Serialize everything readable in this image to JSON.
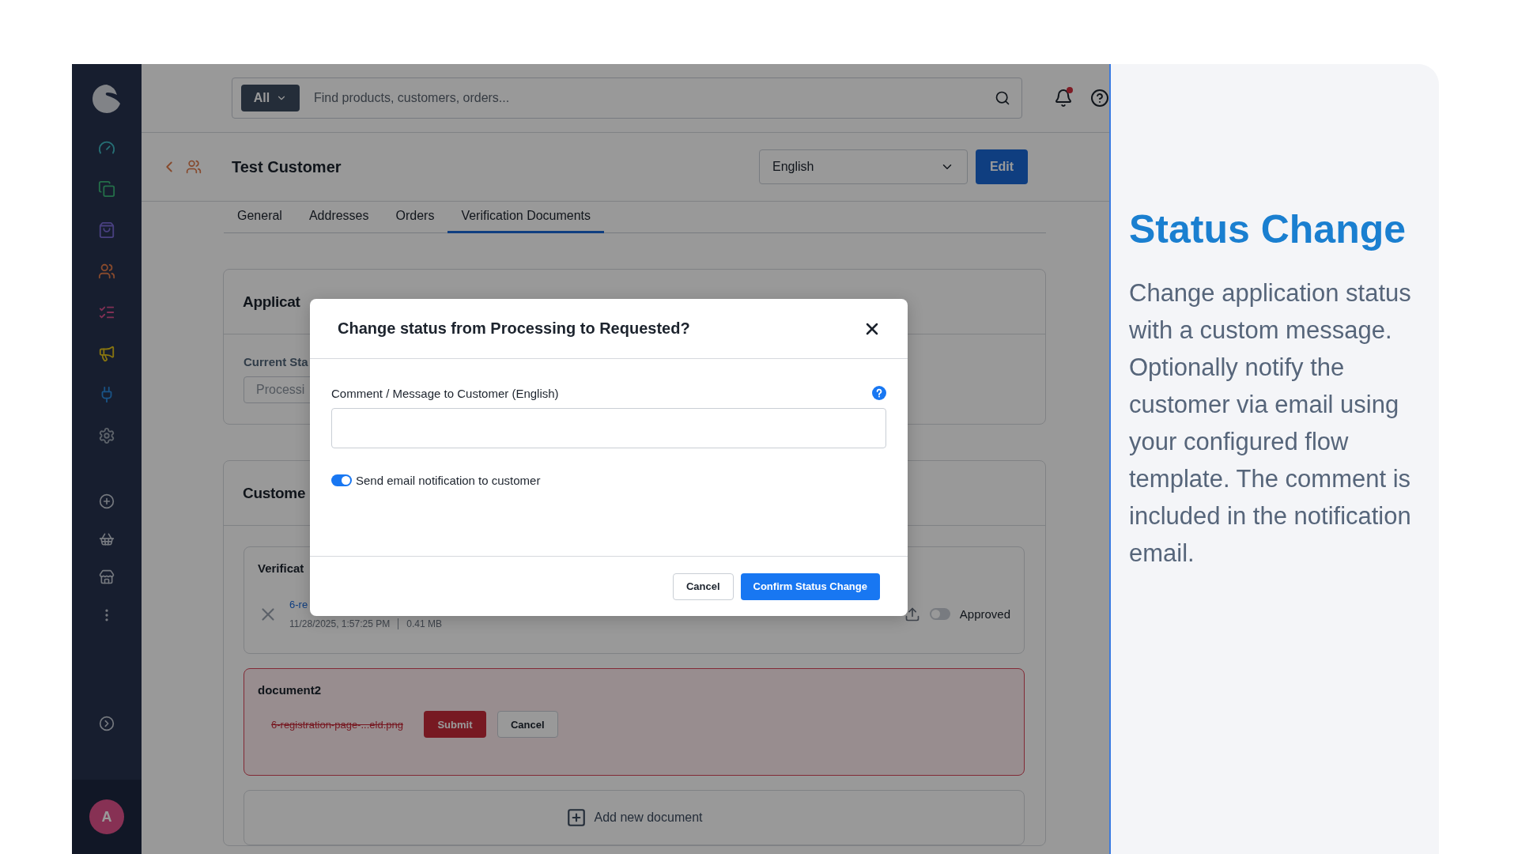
{
  "search": {
    "scope": "All",
    "placeholder": "Find products, customers, orders..."
  },
  "notifications": {
    "unread": true
  },
  "customer": {
    "name": "Test Customer",
    "language": "English",
    "edit": "Edit"
  },
  "tabs": [
    {
      "label": "General",
      "selected": false
    },
    {
      "label": "Addresses",
      "selected": false
    },
    {
      "label": "Orders",
      "selected": false
    },
    {
      "label": "Verification Documents",
      "selected": true
    }
  ],
  "application_status": {
    "title": "Applicat",
    "current_label": "Current Sta",
    "current_value": "Processi"
  },
  "customer_documents": {
    "title": "Custome",
    "documents": [
      {
        "kind": "uploaded",
        "title": "Verificat",
        "file": "6-re",
        "date": "11/28/2025, 1:57:25 PM",
        "size": "0.41 MB",
        "approved": false,
        "approved_label": "Approved"
      },
      {
        "kind": "pending",
        "title": "document2",
        "file": "6-registration-page-...eld.png",
        "submit": "Submit",
        "cancel": "Cancel"
      }
    ],
    "add": "Add new document"
  },
  "avatar": {
    "initial": "A"
  },
  "dialog": {
    "title": "Change status from Processing to Requested?",
    "comment_label": "Comment / Message to Customer (English)",
    "notify": {
      "label": "Send email notification to customer",
      "on": true
    },
    "cancel": "Cancel",
    "confirm": "Confirm Status Change"
  },
  "aside": {
    "title": "Status Change",
    "text": "Change application status with a custom message. Optionally notify the customer via email using your configured flow template. The comment is included in the notification email."
  }
}
